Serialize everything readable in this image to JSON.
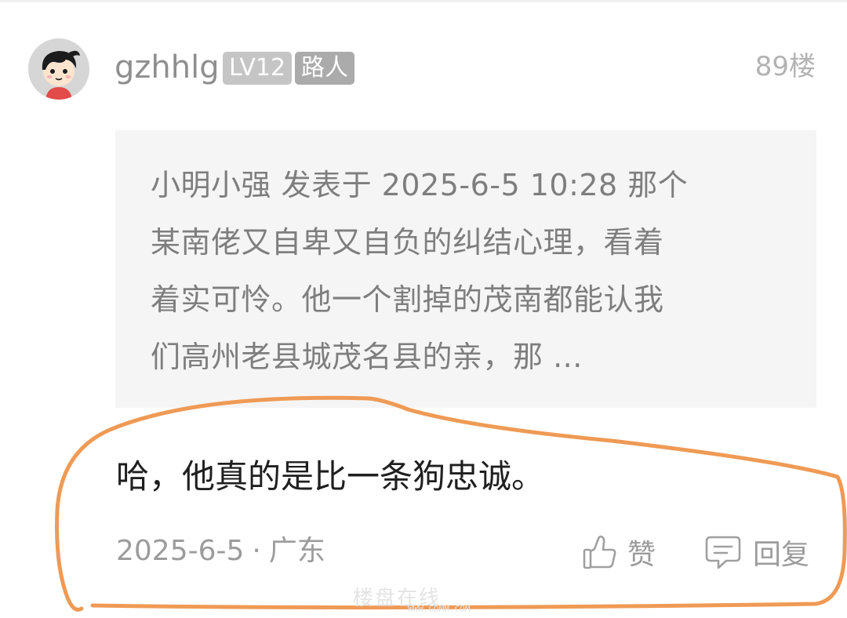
{
  "post": {
    "username": "gzhhlg",
    "level_badge": "LV12",
    "role_badge": "路人",
    "floor": "89楼",
    "avatar_icon": "cartoon-boy-avatar"
  },
  "quote": {
    "lines": [
      "小明小强 发表于 2025-6-5 10:28 那个",
      "某南佬又自卑又自负的纠结心理，看着",
      "着实可怜。他一个割掉的茂南都能认我",
      "们高州老县城茂名县的亲，那 ..."
    ]
  },
  "reply": {
    "text": "哈，他真的是比一条狗忠诚。"
  },
  "meta": {
    "date": "2025-6-5",
    "separator": "·",
    "location": "广东"
  },
  "actions": {
    "like_label": "赞",
    "like_icon": "thumbs-up-icon",
    "reply_label": "回复",
    "reply_icon": "comment-icon"
  },
  "watermark": {
    "text": "楼盘在线",
    "url": "WWW.GDMM.COM"
  },
  "colors": {
    "annotation_stroke": "#ef9a55",
    "quote_background": "#f5f5f5",
    "badge_level": "#c5c5c5",
    "badge_role": "#ababab"
  }
}
